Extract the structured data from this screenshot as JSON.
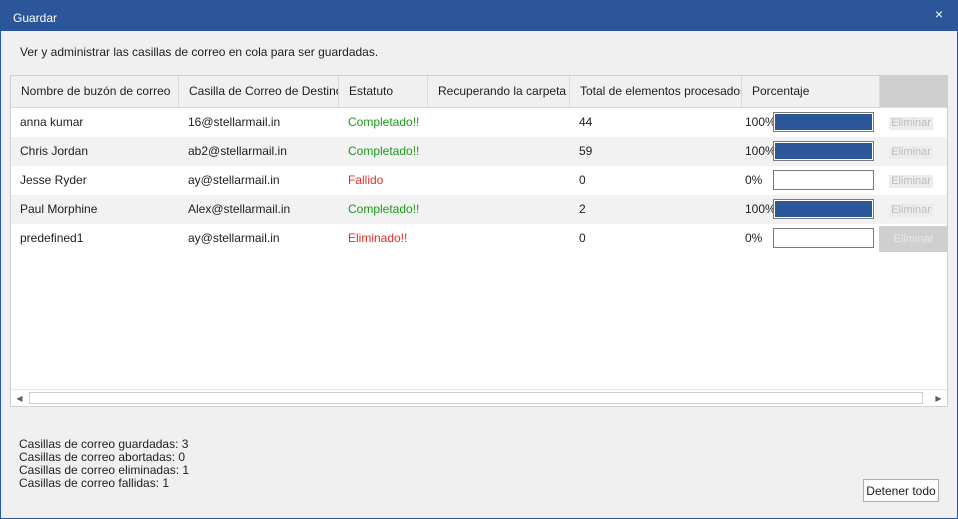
{
  "window": {
    "title": "Guardar",
    "close_glyph": "×"
  },
  "instructions": "Ver y administrar las casillas de correo en cola para ser guardadas.",
  "table": {
    "columns": [
      "Nombre de buzón de correo",
      "Casilla de Correo de Destino",
      "Estatuto",
      "Recuperando la carpeta",
      "Total de elementos procesados",
      "Porcentaje"
    ],
    "rows": [
      {
        "mailbox": "anna kumar",
        "destination": "16@stellarmail.in",
        "status": "Completado!!",
        "status_kind": "ok",
        "folder": "",
        "total": "44",
        "percent_text": "100%",
        "percent_value": 100,
        "action": "Eliminar"
      },
      {
        "mailbox": "Chris Jordan",
        "destination": "ab2@stellarmail.in",
        "status": "Completado!!",
        "status_kind": "ok",
        "folder": "",
        "total": "59",
        "percent_text": "100%",
        "percent_value": 100,
        "action": "Eliminar"
      },
      {
        "mailbox": "Jesse Ryder",
        "destination": "ay@stellarmail.in",
        "status": "Fallido",
        "status_kind": "bad",
        "folder": "",
        "total": "0",
        "percent_text": "0%",
        "percent_value": 0,
        "action": "Eliminar"
      },
      {
        "mailbox": "Paul Morphine",
        "destination": "Alex@stellarmail.in",
        "status": "Completado!!",
        "status_kind": "ok",
        "folder": "",
        "total": "2",
        "percent_text": "100%",
        "percent_value": 100,
        "action": "Eliminar"
      },
      {
        "mailbox": "predefined1",
        "destination": "ay@stellarmail.in",
        "status": "Eliminado!!",
        "status_kind": "bad",
        "folder": "",
        "total": "0",
        "percent_text": "0%",
        "percent_value": 0,
        "action": "Eliminar"
      }
    ]
  },
  "summary": {
    "saved": "Casillas de correo guardadas: 3",
    "aborted": "Casillas de correo abortadas: 0",
    "deleted": "Casillas de correo eliminadas: 1",
    "failed": "Casillas de correo fallidas: 1"
  },
  "buttons": {
    "stop_all": "Detener todo"
  },
  "colors": {
    "accent": "#2b579a",
    "status_ok": "#1c9a1c",
    "status_bad": "#e03030"
  }
}
